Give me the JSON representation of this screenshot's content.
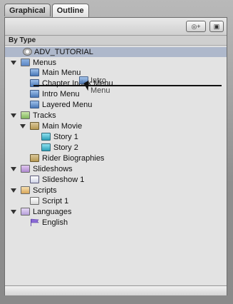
{
  "tabs": [
    {
      "label": "Graphical"
    },
    {
      "label": "Outline"
    }
  ],
  "toolbar": {
    "left_button": "◎+",
    "right_button": "▣"
  },
  "section_header": "By Type",
  "drag_label": "Intro Menu",
  "tree": [
    {
      "label": "ADV_TUTORIAL",
      "icon": "disk-icon",
      "selected": true
    },
    {
      "label": "Menus",
      "icon": "folder-icon",
      "expanded": true
    },
    {
      "label": "Main Menu",
      "icon": "menu-icon"
    },
    {
      "label": "Chapter Index Menu",
      "icon": "menu-icon"
    },
    {
      "label": "Intro Menu",
      "icon": "menu-icon"
    },
    {
      "label": "Layered Menu",
      "icon": "menu-icon"
    },
    {
      "label": "Tracks",
      "icon": "folder-icon",
      "expanded": true
    },
    {
      "label": "Main Movie",
      "icon": "track-icon",
      "expanded": true
    },
    {
      "label": "Story 1",
      "icon": "story-icon"
    },
    {
      "label": "Story 2",
      "icon": "story-icon"
    },
    {
      "label": "Rider Biographies",
      "icon": "track-icon"
    },
    {
      "label": "Slideshows",
      "icon": "folder-icon",
      "expanded": true
    },
    {
      "label": "Slideshow 1",
      "icon": "slideshow-icon"
    },
    {
      "label": "Scripts",
      "icon": "folder-icon",
      "expanded": true
    },
    {
      "label": "Script 1",
      "icon": "script-icon"
    },
    {
      "label": "Languages",
      "icon": "folder-icon",
      "expanded": true
    },
    {
      "label": "English",
      "icon": "flag-icon"
    }
  ]
}
